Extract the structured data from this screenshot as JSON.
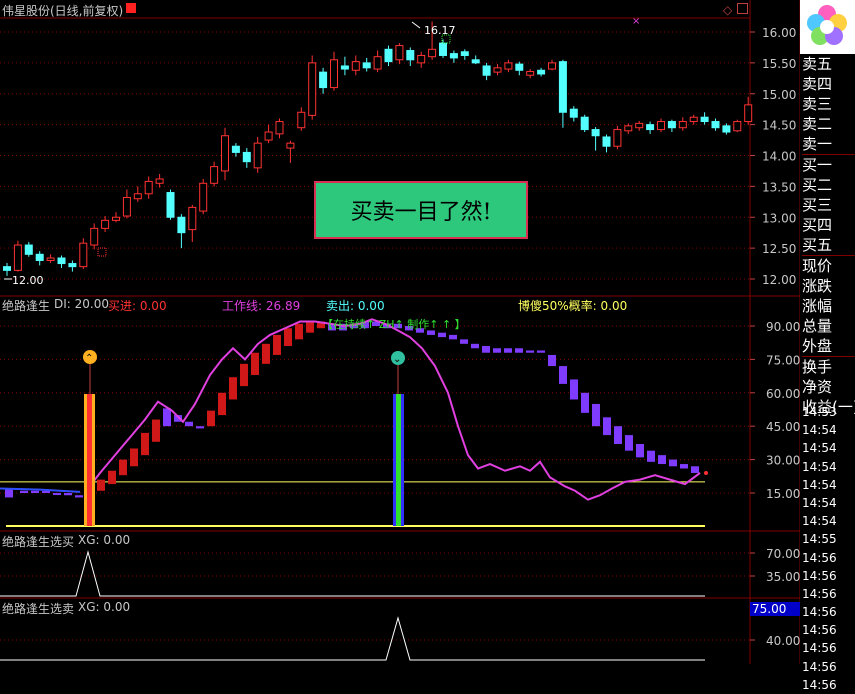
{
  "header": {
    "title": "伟星股份(日线,前复权)"
  },
  "price_panel": {
    "axis": [
      "16.00",
      "15.50",
      "15.00",
      "14.50",
      "14.00",
      "13.50",
      "13.00",
      "12.50",
      "12.00"
    ],
    "high_label": "16.17",
    "low_label": "12.00"
  },
  "promo": {
    "text": "买卖一目了然!"
  },
  "ind1": {
    "name": "绝路逢生",
    "di": "DI: 20.00",
    "buy": "买进: 0.00",
    "work": "工作线: 26.89",
    "sell": "卖出: 0.00",
    "ratio": "博傻50%概率: 0.00",
    "status": "【在持续↑ ZH↑ 制作↑ ↑ 】",
    "axis": [
      "90.00",
      "75.00",
      "60.00",
      "45.00",
      "30.00",
      "15.00"
    ]
  },
  "ind2": {
    "name": "绝路逢生选买",
    "xg": "XG: 0.00",
    "axis": [
      "70.00",
      "35.00"
    ]
  },
  "ind3": {
    "name": "绝路逢生选卖",
    "xg": "XG: 0.00",
    "axis": [
      "40.00"
    ],
    "highlight": "75.00"
  },
  "quote_labels": [
    "卖五",
    "卖四",
    "卖三",
    "卖二",
    "卖一",
    "买一",
    "买二",
    "买三",
    "买四",
    "买五",
    "现价",
    "涨跌",
    "涨幅",
    "总量",
    "外盘",
    "换手",
    "净资",
    "收益(一)"
  ],
  "times": [
    "14:53",
    "14:54",
    "14:54",
    "14:54",
    "14:54",
    "14:54",
    "14:54",
    "14:55",
    "14:56",
    "14:56",
    "14:56",
    "14:56",
    "14:56",
    "14:56",
    "14:56",
    "14:56"
  ],
  "colors": {
    "up": "#ff3232",
    "down": "#54ffff",
    "grid": "#800000",
    "magenta": "#e040e0",
    "purple": "#7f3cff",
    "yellow": "#ffff60"
  },
  "chart_data": {
    "type": "candlestick",
    "candles": [
      [
        12.2,
        12.14,
        12.26,
        12.05
      ],
      [
        12.14,
        12.55,
        12.62,
        12.12
      ],
      [
        12.55,
        12.4,
        12.6,
        12.36
      ],
      [
        12.4,
        12.3,
        12.45,
        12.22
      ],
      [
        12.3,
        12.34,
        12.4,
        12.26
      ],
      [
        12.34,
        12.25,
        12.38,
        12.18
      ],
      [
        12.25,
        12.2,
        12.3,
        12.12
      ],
      [
        12.2,
        12.58,
        12.66,
        12.16
      ],
      [
        12.55,
        12.82,
        12.9,
        12.48
      ],
      [
        12.82,
        12.95,
        13.02,
        12.76
      ],
      [
        12.95,
        13.0,
        13.08,
        12.92
      ],
      [
        13.02,
        13.32,
        13.45,
        12.98
      ],
      [
        13.3,
        13.38,
        13.5,
        13.25
      ],
      [
        13.38,
        13.58,
        13.66,
        13.3
      ],
      [
        13.55,
        13.62,
        13.7,
        13.48
      ],
      [
        13.4,
        13.0,
        13.45,
        12.96
      ],
      [
        13.0,
        12.75,
        13.05,
        12.5
      ],
      [
        12.8,
        13.16,
        13.2,
        12.6
      ],
      [
        13.1,
        13.55,
        13.62,
        13.05
      ],
      [
        13.55,
        13.82,
        13.9,
        13.5
      ],
      [
        13.75,
        14.32,
        14.45,
        13.6
      ],
      [
        14.15,
        14.05,
        14.2,
        13.98
      ],
      [
        14.05,
        13.9,
        14.12,
        13.8
      ],
      [
        13.8,
        14.2,
        14.3,
        13.72
      ],
      [
        14.25,
        14.38,
        14.5,
        14.2
      ],
      [
        14.35,
        14.55,
        14.6,
        14.28
      ],
      [
        14.12,
        14.2,
        14.24,
        13.88
      ],
      [
        14.45,
        14.7,
        14.78,
        14.4
      ],
      [
        14.65,
        15.5,
        15.62,
        14.58
      ],
      [
        15.35,
        15.1,
        15.42,
        15.0
      ],
      [
        15.1,
        15.55,
        15.68,
        15.05
      ],
      [
        15.45,
        15.4,
        15.6,
        15.3
      ],
      [
        15.38,
        15.52,
        15.62,
        15.3
      ],
      [
        15.5,
        15.42,
        15.58,
        15.36
      ],
      [
        15.4,
        15.6,
        15.7,
        15.35
      ],
      [
        15.72,
        15.52,
        15.78,
        15.45
      ],
      [
        15.55,
        15.78,
        15.82,
        15.48
      ],
      [
        15.7,
        15.55,
        15.75,
        15.45
      ],
      [
        15.5,
        15.62,
        15.68,
        15.42
      ],
      [
        15.6,
        15.72,
        16.17,
        15.55
      ],
      [
        15.82,
        15.62,
        15.88,
        15.58
      ],
      [
        15.65,
        15.58,
        15.7,
        15.5
      ],
      [
        15.68,
        15.62,
        15.72,
        15.55
      ],
      [
        15.55,
        15.5,
        15.62,
        15.48
      ],
      [
        15.45,
        15.3,
        15.5,
        15.22
      ],
      [
        15.35,
        15.42,
        15.48,
        15.3
      ],
      [
        15.4,
        15.5,
        15.55,
        15.35
      ],
      [
        15.48,
        15.38,
        15.52,
        15.3
      ],
      [
        15.3,
        15.36,
        15.4,
        15.25
      ],
      [
        15.38,
        15.32,
        15.42,
        15.28
      ],
      [
        15.4,
        15.5,
        15.55,
        15.38
      ],
      [
        15.52,
        14.7,
        15.55,
        14.45
      ],
      [
        14.75,
        14.62,
        14.8,
        14.55
      ],
      [
        14.62,
        14.42,
        14.66,
        14.38
      ],
      [
        14.42,
        14.32,
        14.46,
        14.08
      ],
      [
        14.3,
        14.15,
        14.34,
        14.05
      ],
      [
        14.15,
        14.42,
        14.48,
        14.1
      ],
      [
        14.4,
        14.48,
        14.52,
        14.35
      ],
      [
        14.45,
        14.52,
        14.56,
        14.4
      ],
      [
        14.5,
        14.42,
        14.55,
        14.35
      ],
      [
        14.42,
        14.55,
        14.6,
        14.38
      ],
      [
        14.55,
        14.45,
        14.58,
        14.38
      ],
      [
        14.45,
        14.55,
        14.62,
        14.4
      ],
      [
        14.55,
        14.62,
        14.66,
        14.5
      ],
      [
        14.62,
        14.55,
        14.7,
        14.5
      ],
      [
        14.55,
        14.45,
        14.6,
        14.4
      ],
      [
        14.48,
        14.38,
        14.52,
        14.34
      ],
      [
        14.4,
        14.55,
        14.58,
        14.38
      ],
      [
        14.55,
        14.82,
        14.95,
        14.5
      ]
    ]
  }
}
